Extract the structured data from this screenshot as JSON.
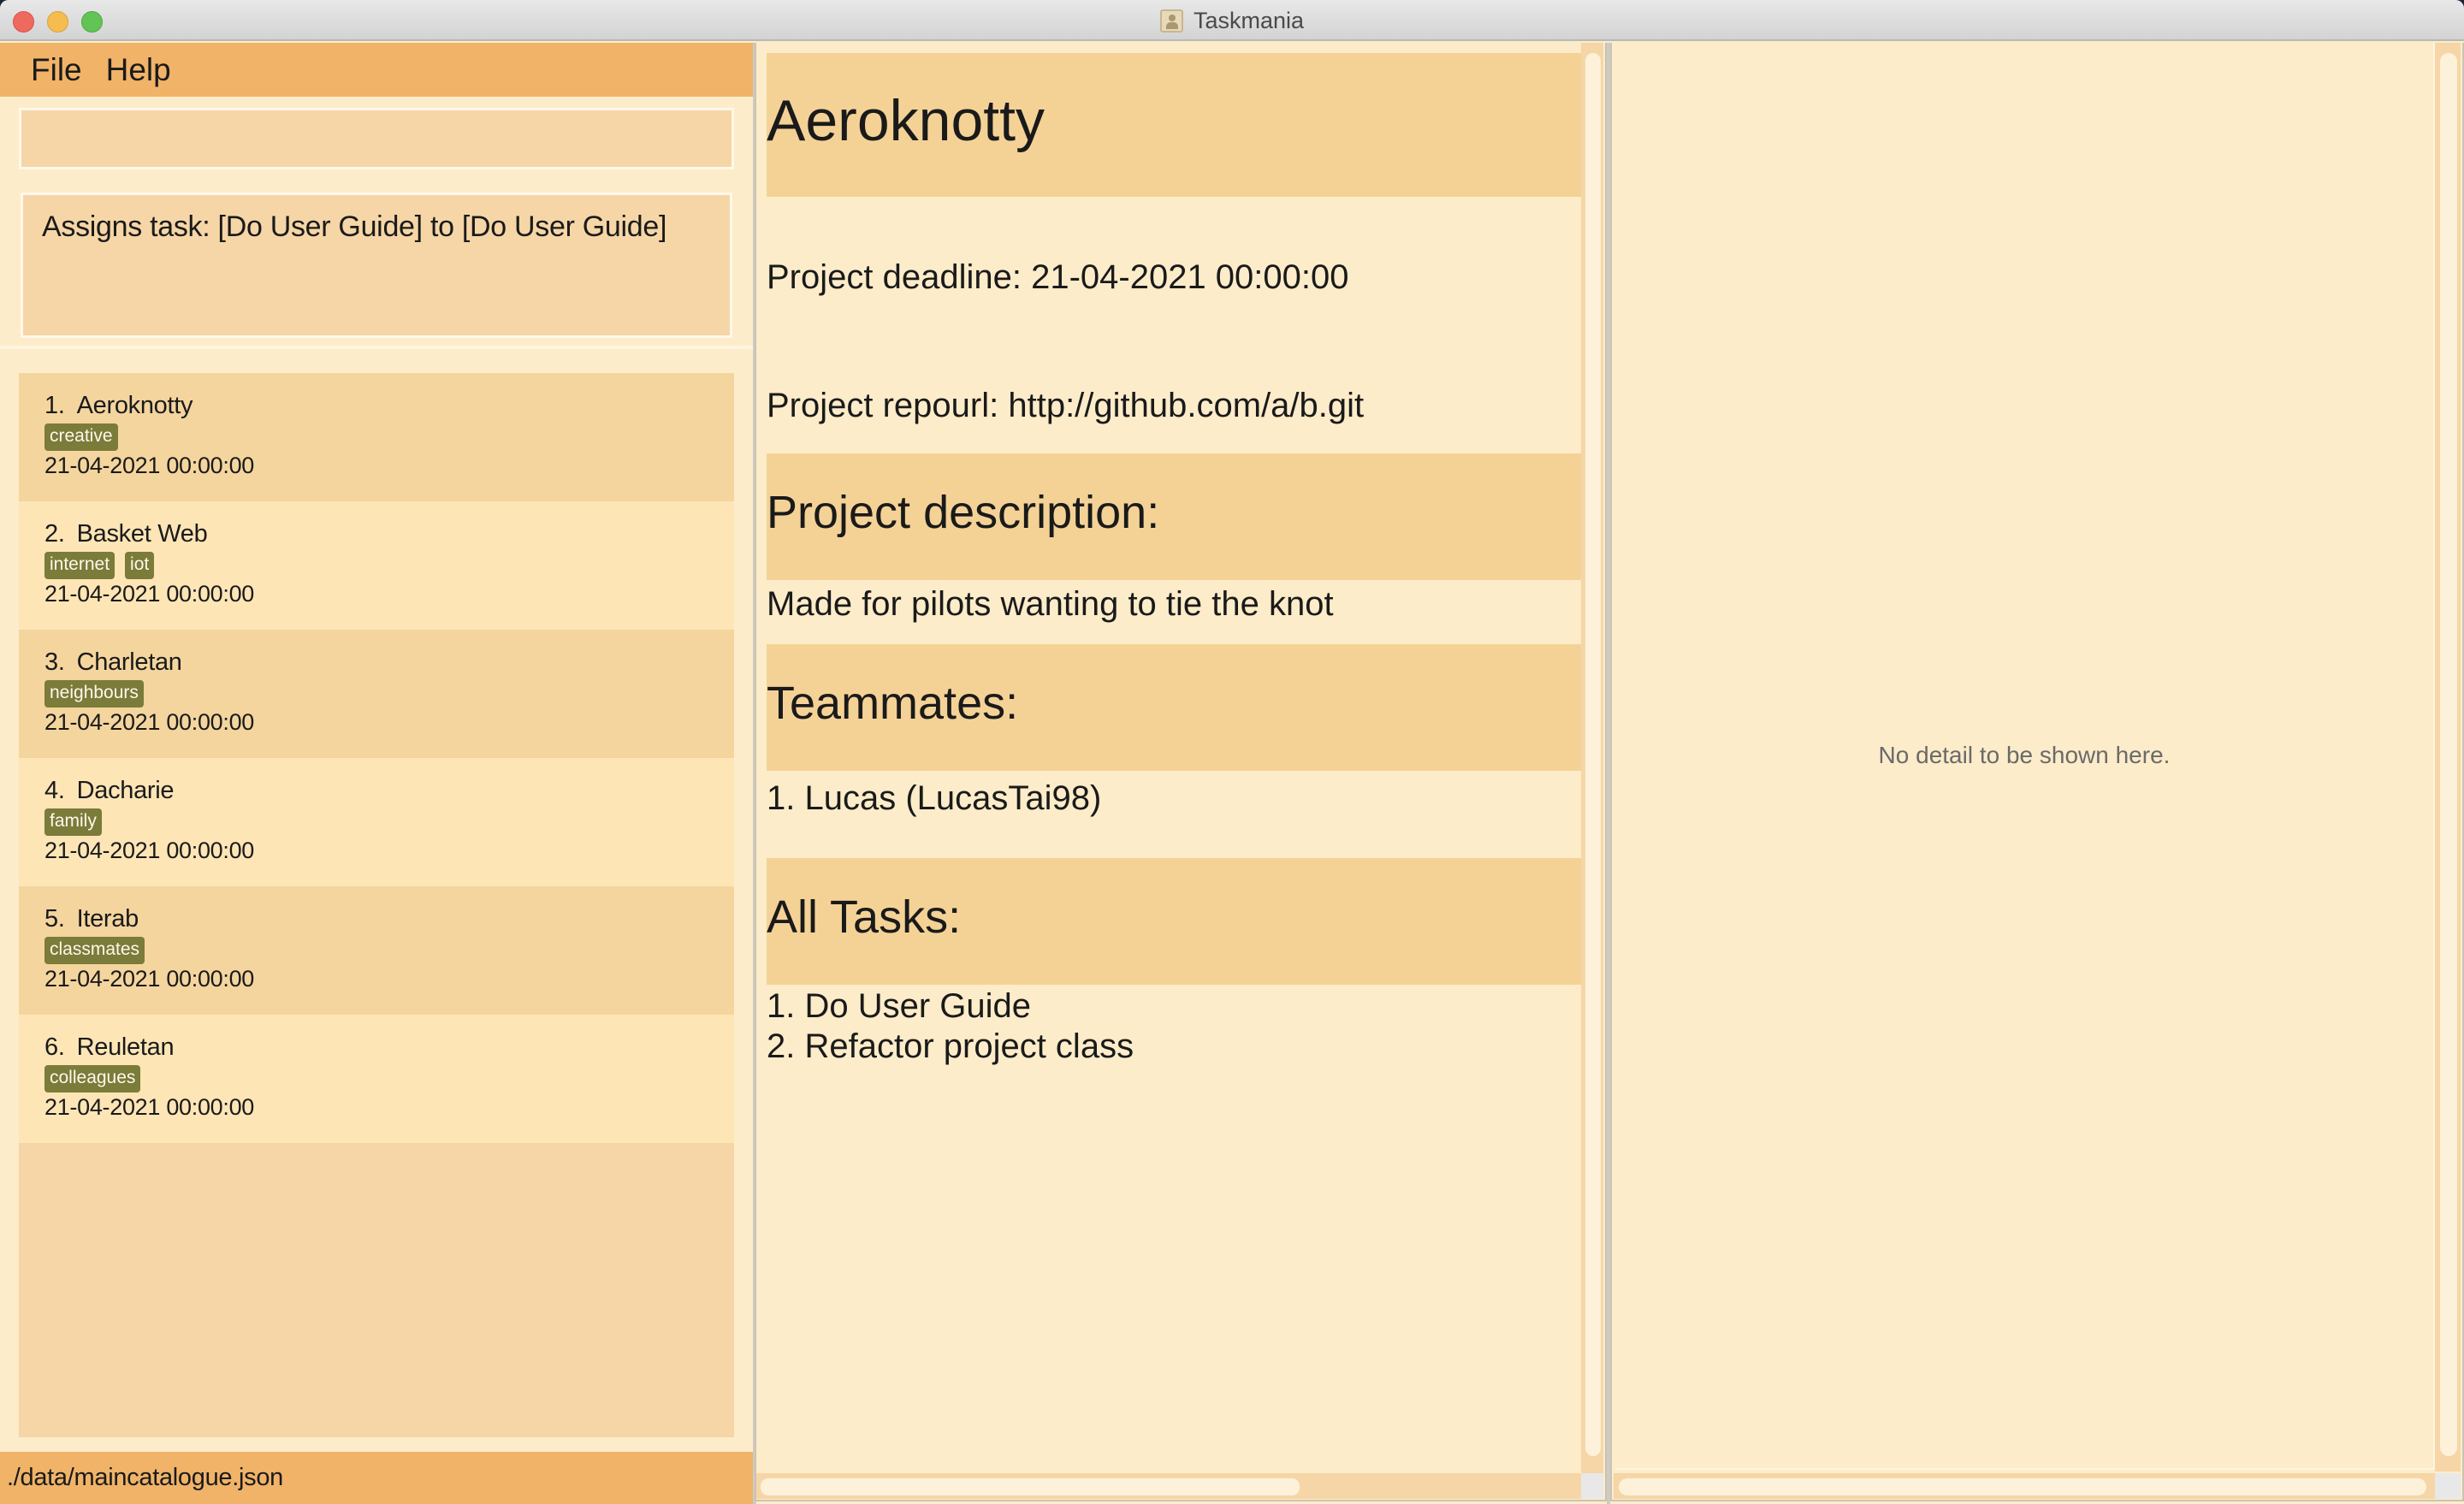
{
  "window": {
    "title": "Taskmania",
    "app_icon": "contacts-book-icon"
  },
  "menu": {
    "items": [
      {
        "label": "File"
      },
      {
        "label": "Help"
      }
    ]
  },
  "command": {
    "value": "",
    "placeholder": ""
  },
  "result": {
    "text": "Assigns task: [Do User Guide] to [Do User Guide]"
  },
  "projects": [
    {
      "index": "1.",
      "name": "Aeroknotty",
      "tags": [
        "creative"
      ],
      "deadline": "21-04-2021 00:00:00"
    },
    {
      "index": "2.",
      "name": "Basket Web",
      "tags": [
        "internet",
        "iot"
      ],
      "deadline": "21-04-2021 00:00:00"
    },
    {
      "index": "3.",
      "name": "Charletan",
      "tags": [
        "neighbours"
      ],
      "deadline": "21-04-2021 00:00:00"
    },
    {
      "index": "4.",
      "name": "Dacharie",
      "tags": [
        "family"
      ],
      "deadline": "21-04-2021 00:00:00"
    },
    {
      "index": "5.",
      "name": "Iterab",
      "tags": [
        "classmates"
      ],
      "deadline": "21-04-2021 00:00:00"
    },
    {
      "index": "6.",
      "name": "Reuletan",
      "tags": [
        "colleagues"
      ],
      "deadline": "21-04-2021 00:00:00"
    }
  ],
  "status": {
    "file_path": "./data/maincatalogue.json"
  },
  "project_detail": {
    "title": "Aeroknotty",
    "deadline": "Project deadline: 21-04-2021 00:00:00",
    "repourl": "Project repourl: http://github.com/a/b.git",
    "description_heading": "Project description:",
    "description": "Made for pilots wanting to tie the knot",
    "teammates_heading": "Teammates:",
    "teammates": [
      "1. Lucas (LucasTai98)"
    ],
    "tasks_heading": "All Tasks:",
    "tasks": [
      "1. Do User Guide",
      "2. Refactor project class"
    ]
  },
  "detail_panel": {
    "empty_message": "No detail to be shown here."
  },
  "colors": {
    "menu_bar": "#f0b368",
    "panel_bg": "#fdecc9",
    "section_header": "#f4d296",
    "tag_bg": "#7b7b3a",
    "list_item_odd": "#f4d59e",
    "list_item_even": "#fde5b6"
  }
}
